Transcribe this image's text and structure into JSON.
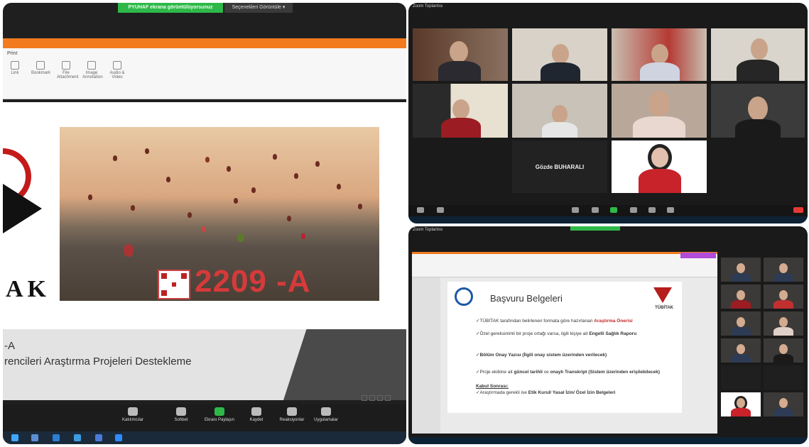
{
  "left": {
    "banner_green": "PYUHAF ekrana görüntülüyorsunuz",
    "banner_dark": "Seçenekleri Görüntüle ▾",
    "ribbon_tab": "Print",
    "ribbon_tools": [
      "Link",
      "Bookmark",
      "File Attachment",
      "Image Annotation",
      "Audio & Video"
    ],
    "slide": {
      "logo_text": "AK",
      "code": "2209 -A",
      "line1": "-A",
      "line2": "rencileri Araştırma Projeleri Destekleme"
    },
    "toolbar": [
      "Katılımcılar",
      "Sohbet",
      "Ekranı Paylaşın",
      "Kaydet",
      "Reaksiyonlar",
      "Uygulamalar"
    ]
  },
  "right_top": {
    "window_title": "Zoom Toplantısı",
    "named_participant": "Gözde BUHARALI"
  },
  "right_bottom": {
    "window_title": "Zoom Toplantısı",
    "slide_title": "Başvuru Belgeleri",
    "logo_label": "TÜBİTAK",
    "bullets": {
      "b1_pre": "TÜBİTAK tarafından belirlenen formata göre hazırlanan ",
      "b1_hl": "Araştırma Önerisi",
      "b2_pre": "Özel gereksinimli bir proje ortağı varsa, ilgili kişiye ait ",
      "b2_bold": "Engelli Sağlık Raporu",
      "b3": "Bölüm Onay Yazısı (İlgili onay sistem üzerinden verilecek)",
      "b4_pre": "Proje ekibine ait ",
      "b4_bold1": "güncel tarihli",
      "b4_mid": " ve ",
      "b4_bold2": "onaylı Transkript (Sistem üzerinden erişilebilecek)",
      "b5_head": "Kabul Sonrası:",
      "b5_pre": "Araştırmada gerekli ise ",
      "b5_bold": "Etik Kurul/ Yasal İzin/ Özel İzin Belgeleri"
    }
  }
}
